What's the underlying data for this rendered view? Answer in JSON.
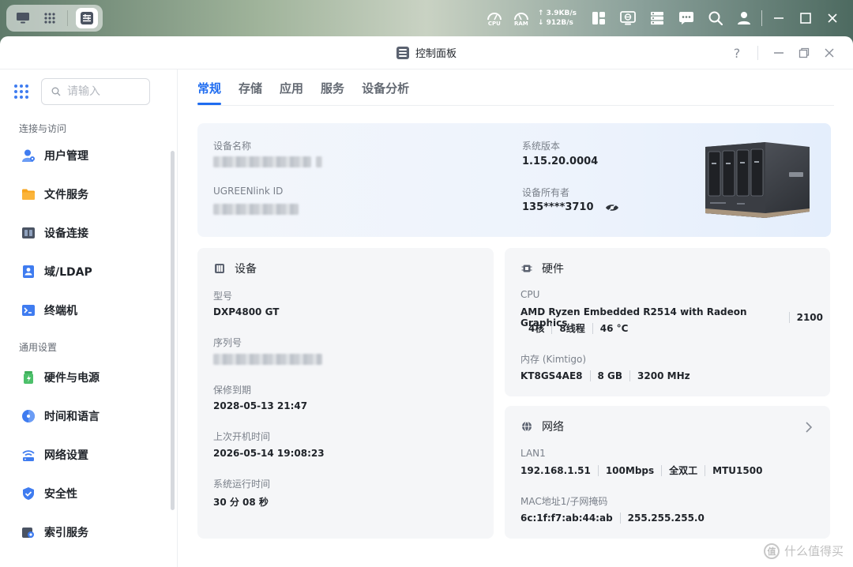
{
  "topbar": {
    "cpu_label": "CPU",
    "ram_label": "RAM",
    "upload_speed": "↑ 3.9KB/s",
    "download_speed": "↓ 912B/s"
  },
  "window": {
    "title": "控制面板"
  },
  "sidebar": {
    "search_placeholder": "请输入",
    "sections": [
      {
        "title": "连接与访问",
        "items": [
          {
            "label": "用户管理",
            "icon": "user-icon"
          },
          {
            "label": "文件服务",
            "icon": "folder-icon"
          },
          {
            "label": "设备连接",
            "icon": "device-connect-icon"
          },
          {
            "label": "域/LDAP",
            "icon": "ldap-icon"
          },
          {
            "label": "终端机",
            "icon": "terminal-icon"
          }
        ]
      },
      {
        "title": "通用设置",
        "items": [
          {
            "label": "硬件与电源",
            "icon": "hardware-power-icon"
          },
          {
            "label": "时间和语言",
            "icon": "time-language-icon"
          },
          {
            "label": "网络设置",
            "icon": "network-settings-icon"
          },
          {
            "label": "安全性",
            "icon": "shield-icon"
          },
          {
            "label": "索引服务",
            "icon": "index-service-icon"
          }
        ]
      }
    ]
  },
  "tabs": [
    {
      "label": "常规",
      "active": true
    },
    {
      "label": "存储",
      "active": false
    },
    {
      "label": "应用",
      "active": false
    },
    {
      "label": "服务",
      "active": false
    },
    {
      "label": "设备分析",
      "active": false
    }
  ],
  "overview": {
    "device_name_label": "设备名称",
    "ugreenlink_label": "UGREENlink ID",
    "system_version_label": "系统版本",
    "system_version": "1.15.20.0004",
    "owner_label": "设备所有者",
    "owner": "135****3710"
  },
  "device_card": {
    "title": "设备",
    "model_label": "型号",
    "model": "DXP4800 GT",
    "serial_label": "序列号",
    "warranty_label": "保修到期",
    "warranty": "2028-05-13 21:47",
    "last_boot_label": "上次开机时间",
    "last_boot": "2026-05-14 19:08:23",
    "uptime_label": "系统运行时间",
    "uptime": "30 分 08 秒"
  },
  "hardware_card": {
    "title": "硬件",
    "cpu_label": "CPU",
    "cpu_line1": [
      "AMD Ryzen Embedded R2514 with Radeon Graphics",
      "2100"
    ],
    "cpu_line2": [
      "4核",
      "8线程",
      "46 °C"
    ],
    "memory_label": "内存 (Kimtigo)",
    "memory_line": [
      "KT8GS4AE8",
      "8 GB",
      "3200 MHz"
    ]
  },
  "network_card": {
    "title": "网络",
    "lan_label": "LAN1",
    "lan_line": [
      "192.168.1.51",
      "100Mbps",
      "全双工",
      "MTU1500"
    ],
    "mac_label": "MAC地址1/子网掩码",
    "mac_line": [
      "6c:1f:f7:ab:44:ab",
      "255.255.255.0"
    ]
  },
  "watermark": {
    "text": "什么值得买",
    "logo_char": "值"
  }
}
